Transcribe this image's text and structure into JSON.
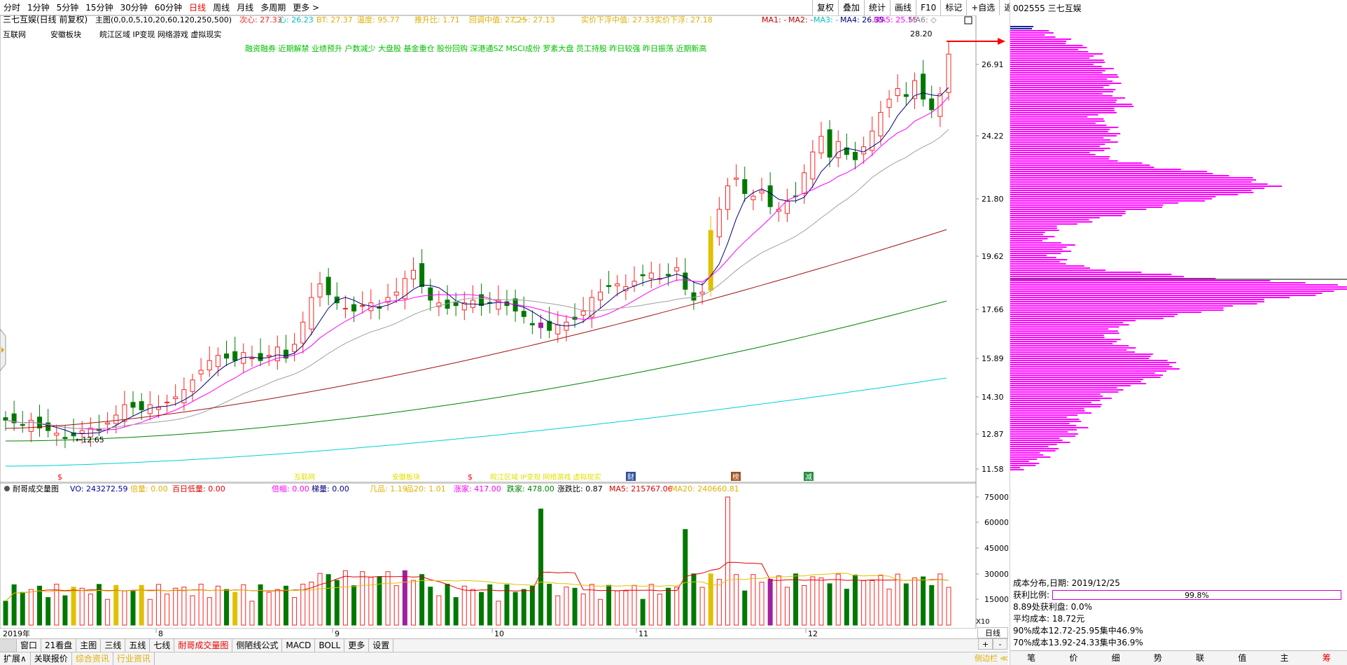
{
  "toolbar": {
    "tabs": [
      "分时",
      "1分钟",
      "5分钟",
      "15分钟",
      "30分钟",
      "60分钟",
      "日线",
      "周线",
      "月线",
      "多周期",
      "更多 >"
    ],
    "active": "日线",
    "right_buttons": [
      "复权",
      "叠加",
      "统计",
      "画线",
      "F10",
      "标记",
      "+自选",
      "返回"
    ]
  },
  "chart_header": {
    "stock_label": "三七互娱(日线 前复权)",
    "main_indicator": "主图(0,0,0,5,10,20,60,120,250,500)",
    "items": [
      {
        "text": "次心: 27.33",
        "color": "#ff2020"
      },
      {
        "text": "心: 26.23",
        "color": "#00c0c0"
      },
      {
        "text": "BT: 27.37",
        "color": "#e0b000"
      },
      {
        "text": "温度: 95.77",
        "color": "#e0b000"
      },
      {
        "text": "推升比: 1.71",
        "color": "#e0b000"
      },
      {
        "text": "回调中值: 27.25",
        "color": "#e0b000"
      },
      {
        "text": "二一: 27.13",
        "color": "#e0b000"
      },
      {
        "text": "实价下浮中值: 27.33",
        "color": "#e0b000"
      },
      {
        "text": "实价下浮: 27.18",
        "color": "#e0b000"
      }
    ],
    "ma_items": [
      {
        "text": "MA1: -",
        "color": "#c00000"
      },
      {
        "text": "MA2: -",
        "color": "#c00000"
      },
      {
        "text": "MA3: -",
        "color": "#00c0c0"
      },
      {
        "text": "MA4: 26.35",
        "color": "#000080"
      },
      {
        "text": "MA5: 25.55",
        "color": "#ff00ff"
      },
      {
        "text": "MA6: ◇",
        "color": "#808080"
      }
    ]
  },
  "concepts_row1": [
    "互联网",
    "安徽板块",
    "皖江区域 IP变现 网络游戏 虚拟现实"
  ],
  "concepts_row2": "融资融券 近期解禁 业绩预升 户数减少 大盘股 基金重仓 股份回购 深港通SZ MSCI成份 罗素大盘 员工持股 昨日较强 昨日振荡 近期新高",
  "price_axis": [
    "26.91",
    "24.22",
    "21.80",
    "19.62",
    "17.66",
    "15.89",
    "14.30",
    "12.87",
    "11.58"
  ],
  "price_annotations": {
    "high": "28.20",
    "low": "12.65"
  },
  "events": [
    {
      "label": "$",
      "color": "#ff0000"
    },
    {
      "label": "互联网",
      "color": "#e0e000"
    },
    {
      "label": "安徽板块",
      "color": "#e0e000"
    },
    {
      "label": "$",
      "color": "#ff0000"
    },
    {
      "label": "皖江区域 IP变现 网络游戏 虚拟现实",
      "color": "#e0e000"
    },
    {
      "label": "财",
      "color": "#ffffff"
    },
    {
      "label": "榜",
      "color": "#ffffff"
    },
    {
      "label": "减",
      "color": "#ffffff"
    }
  ],
  "volume_header": {
    "title": "耐哥成交量图",
    "items": [
      {
        "text": "VO: 243272.59",
        "color": "#0000a0"
      },
      {
        "text": "倍量: 0.00",
        "color": "#e0b000"
      },
      {
        "text": "百日低量: 0.00",
        "color": "#e00000"
      },
      {
        "text": "倍缩: 0.00",
        "color": "#ff00ff"
      },
      {
        "text": "梯量: 0.00",
        "color": "#000080"
      },
      {
        "text": "几品: 1.19",
        "color": "#e0b000"
      },
      {
        "text": "品20: 1.01",
        "color": "#e0b000"
      },
      {
        "text": "涨家: 417.00",
        "color": "#ff00ff"
      },
      {
        "text": "跌家: 478.00",
        "color": "#008000"
      },
      {
        "text": "涨跌比: 0.87",
        "color": "#000000"
      },
      {
        "text": "MA5: 215767.06",
        "color": "#e00000"
      },
      {
        "text": "MA20: 240660.81",
        "color": "#e0b000"
      }
    ]
  },
  "volume_axis": [
    "75000",
    "60000",
    "45000",
    "30000",
    "15000"
  ],
  "volume_unit": "X10",
  "dates": [
    "2019年",
    "8",
    "9",
    "10",
    "11",
    "12"
  ],
  "bottom_tabs": [
    "窗口",
    "21看盘",
    "主图",
    "三线",
    "五线",
    "七线",
    "耐哥成交量图",
    "侧陋线公式",
    "MACD",
    "BOLL",
    "更多",
    "设置"
  ],
  "bottom_tabs_active": "耐哥成交量图",
  "bottom_tabs2": [
    "扩展∧",
    "关联报价",
    "综合资讯",
    "行业资讯"
  ],
  "right_buttons2": [
    "日线",
    "+",
    "-"
  ],
  "side_label": "侧边栏 ≪",
  "right_panel": {
    "code_name": "002555 三七互娱",
    "cost_title": "成本分布,日期: 2019/12/25",
    "profit_label": "获利比例:",
    "profit_value": "99.8%",
    "profit_fraction": 0.998,
    "row1": "8.89处获利盘: 0.0%",
    "row2": "平均成本: 18.72元",
    "row3": "90%成本12.72-25.95集中46.9%",
    "row4": "70%成本13.92-24.33集中36.9%",
    "bottom": [
      "笔",
      "价",
      "细",
      "势",
      "联",
      "值",
      "主",
      "筹"
    ]
  },
  "chart_data": {
    "type": "candlestick",
    "x": [
      "2019-07",
      "2019-08",
      "2019-09",
      "2019-10",
      "2019-11",
      "2019-12"
    ],
    "ylim": [
      11.0,
      28.5
    ],
    "close_approx": [
      13.3,
      13.1,
      12.9,
      13.4,
      14.2,
      15.6,
      18.6,
      17.6,
      18.3,
      17.9,
      17.8,
      17.1,
      19.2,
      22.4,
      22.0,
      24.0,
      25.2,
      27.3
    ],
    "volume_ylim": [
      0,
      80000
    ],
    "legend": [
      "MA1",
      "MA2",
      "MA3",
      "MA4",
      "MA5",
      "MA6"
    ]
  }
}
